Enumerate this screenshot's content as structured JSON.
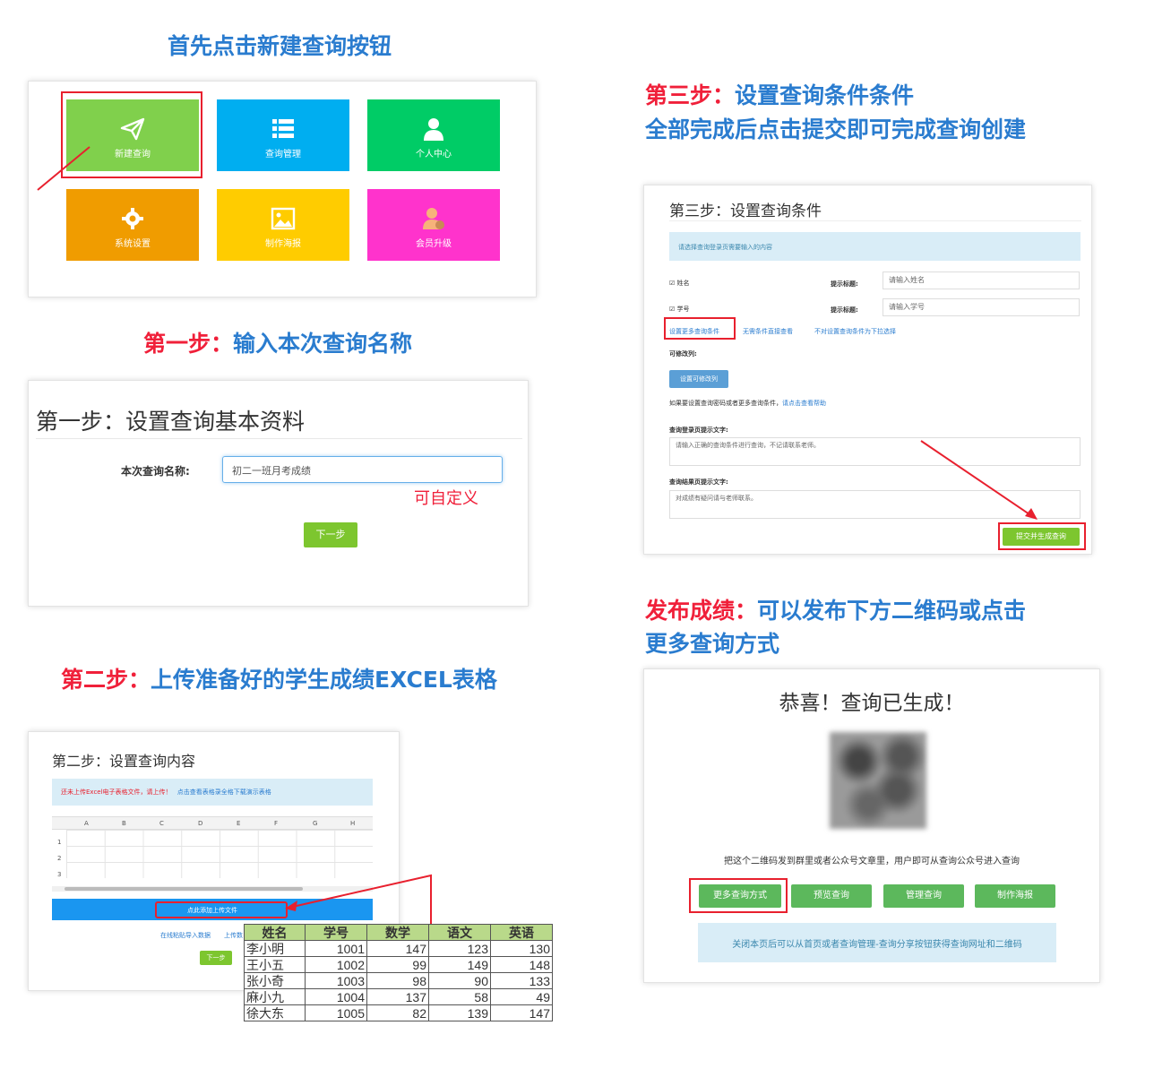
{
  "intro": {
    "heading": "首先点击新建查询按钮"
  },
  "tiles": [
    {
      "label": "新建查询",
      "color": "#80d04c"
    },
    {
      "label": "查询管理",
      "color": "#00aef0"
    },
    {
      "label": "个人中心",
      "color": "#00cc66"
    },
    {
      "label": "系统设置",
      "color": "#f09c00"
    },
    {
      "label": "制作海报",
      "color": "#ffcc00"
    },
    {
      "label": "会员升级",
      "color": "#ff33cc"
    }
  ],
  "step1": {
    "heading_prefix": "第一步：",
    "heading_text": "输入本次查询名称",
    "title": "第一步：设置查询基本资料",
    "field_label": "本次查询名称:",
    "field_value": "初二一班月考成绩",
    "custom_note": "可自定义",
    "next_button": "下一步"
  },
  "step2": {
    "heading_prefix": "第二步：",
    "heading_text": "上传准备好的学生成绩EXCEL表格",
    "title": "第二步：设置查询内容",
    "notice_red": "还未上传Excel电子表格文件，请上传！",
    "notice_blue": "点击查看表格录全格下载演示表格",
    "columns": [
      "A",
      "B",
      "C",
      "D",
      "E",
      "F",
      "G",
      "H"
    ],
    "rows": [
      "1",
      "2",
      "3"
    ],
    "upload_button": "点此添加上传文件",
    "link1": "在线粘贴导入数据",
    "link2": "上传数",
    "next_button": "下一步",
    "excel": {
      "headers": [
        "姓名",
        "学号",
        "数学",
        "语文",
        "英语"
      ],
      "rows": [
        [
          "李小明",
          "1001",
          "147",
          "123",
          "130"
        ],
        [
          "王小五",
          "1002",
          "99",
          "149",
          "148"
        ],
        [
          "张小奇",
          "1003",
          "98",
          "90",
          "133"
        ],
        [
          "麻小九",
          "1004",
          "137",
          "58",
          "49"
        ],
        [
          "徐大东",
          "1005",
          "82",
          "139",
          "147"
        ]
      ]
    }
  },
  "step3": {
    "heading_prefix": "第三步：",
    "heading_text": "设置查询条件条件",
    "heading_line2": "全部完成后点击提交即可完成查询创建",
    "title": "第三步：设置查询条件",
    "notice": "请选择查询登录页需要输入的内容",
    "cond1_label": "姓名",
    "cond1_hint_label": "提示标题:",
    "cond1_placeholder": "请输入姓名",
    "cond2_label": "学号",
    "cond2_hint_label": "提示标题:",
    "cond2_placeholder": "请输入学号",
    "link_more": "设置更多查询条件",
    "link_nocond": "无需条件直接查看",
    "link_dropdown": "不对设置查询条件为下拉选择",
    "editable_label": "可修改列:",
    "editable_button": "设置可修改列",
    "help_text": "如果要设置查询密码或者更多查询条件，",
    "help_link": "请点击查看帮助",
    "login_tip_label": "查询登录页提示文字:",
    "login_tip_value": "请输入正确的查询条件进行查询，不记请联系老师。",
    "result_tip_label": "查询结果页提示文字:",
    "result_tip_value": "对成绩有疑问请与老师联系。",
    "submit_button": "提交并生成查询"
  },
  "publish": {
    "heading_prefix": "发布成绩：",
    "heading_text": "可以发布下方二维码或点击",
    "heading_line2": "更多查询方式",
    "title": "恭喜！查询已生成！",
    "desc": "把这个二维码发到群里或者公众号文章里，用户即可从查询公众号进入查询",
    "buttons": [
      "更多查询方式",
      "预览查询",
      "管理查询",
      "制作海报"
    ],
    "footer": "关闭本页后可以从首页或者查询管理-查询分享按钮获得查询网址和二维码"
  }
}
